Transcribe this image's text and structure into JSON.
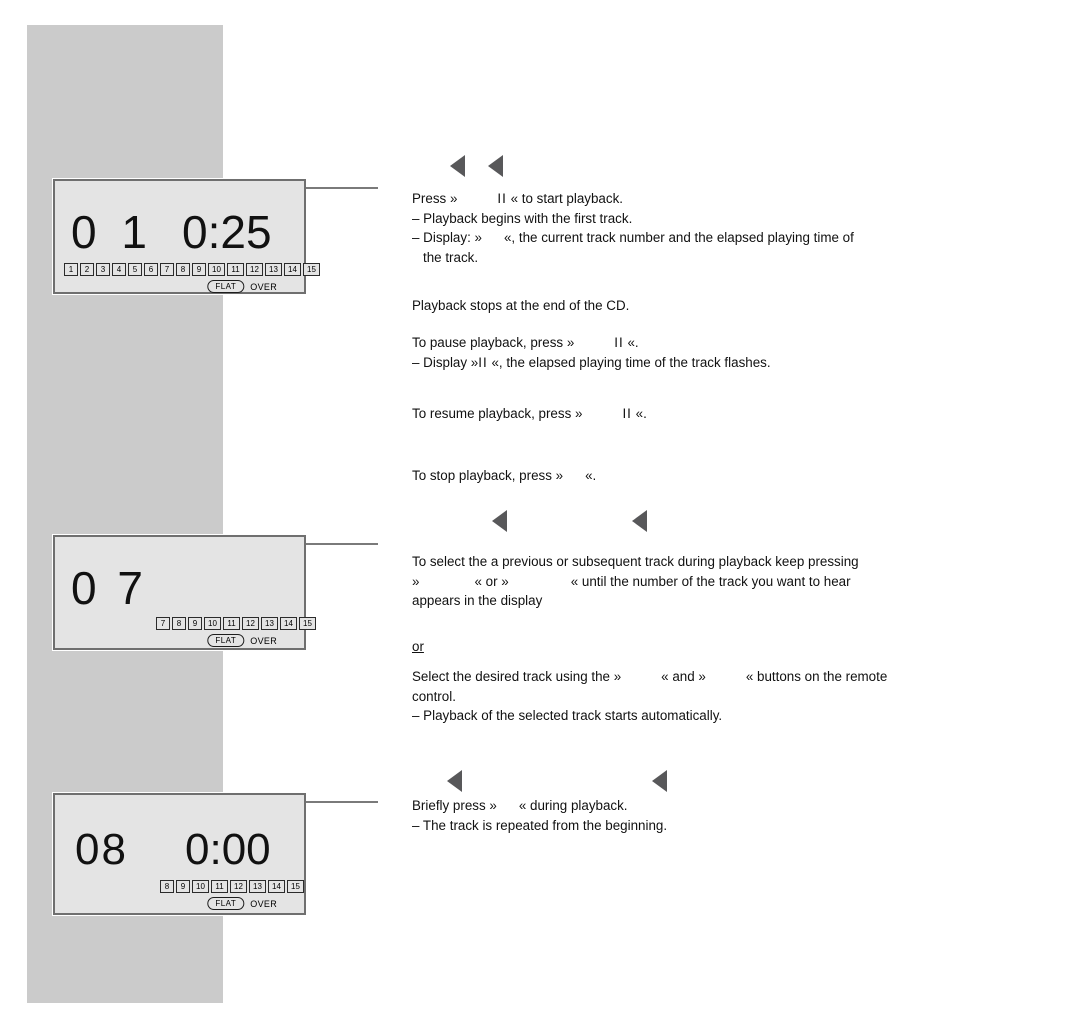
{
  "page": {
    "background_color": "#ffffff",
    "band_color": "#cbcbcb",
    "icon_color": "#58585a",
    "display_bg": "#e4e4e4",
    "display_border": "#6f6f6f"
  },
  "displays": [
    {
      "id": "display-1",
      "track_number": "0 1",
      "time": "0:25",
      "track_boxes": [
        "1",
        "2",
        "3",
        "4",
        "5",
        "6",
        "7",
        "8",
        "9",
        "10",
        "11",
        "12",
        "13",
        "14",
        "15"
      ],
      "flat_label": "FLAT",
      "over_label": "OVER"
    },
    {
      "id": "display-2",
      "track_number": "0 7",
      "time": "",
      "track_boxes": [
        "7",
        "8",
        "9",
        "10",
        "11",
        "12",
        "13",
        "14",
        "15"
      ],
      "flat_label": "FLAT",
      "over_label": "OVER"
    },
    {
      "id": "display-3",
      "track_number": "08",
      "time": "0:00",
      "track_boxes": [
        "8",
        "9",
        "10",
        "11",
        "12",
        "13",
        "14",
        "15"
      ],
      "flat_label": "FLAT",
      "over_label": "OVER"
    }
  ],
  "icons": {
    "rewind_triangle": "rewind-triangle-icon",
    "pause_bars": "II"
  },
  "text": {
    "press_play": {
      "line1_a": "Press »",
      "line1_pause": "II",
      "line1_b": "« to start playback.",
      "line2": "– Playback begins with the first track.",
      "line3_a": "– Display: »",
      "line3_b": "«, the current track number and the elapsed playing time of",
      "line4": "the track."
    },
    "playback_stops": "Playback stops at the end of the CD.",
    "pause": {
      "line1_a": "To pause playback, press »",
      "line1_pause": "II",
      "line1_b": "«.",
      "line2_a": "– Display »",
      "line2_pause": "II",
      "line2_b": "«, the elapsed playing time of the track flashes."
    },
    "resume": {
      "line1_a": "To resume playback, press »",
      "line1_pause": "II",
      "line1_b": "«."
    },
    "stop": {
      "line1_a": "To stop playback, press »",
      "line1_b": "«."
    },
    "select_track": {
      "line1": "To select the a previous or subsequent track during playback keep pressing",
      "line2_a": "»",
      "line2_b": "« or »",
      "line2_c": "« until the number of the track you want to hear",
      "line3": "appears in the display"
    },
    "or": "or",
    "remote": {
      "line1_a": "Select the desired track using the »",
      "line1_b": "« and »",
      "line1_c": "« buttons on the remote",
      "line2": "control.",
      "line3": "– Playback of the selected track starts automatically."
    },
    "briefly": {
      "line1_a": "Briefly press »",
      "line1_b": "« during playback.",
      "line2": "– The track is repeated from the beginning."
    }
  }
}
